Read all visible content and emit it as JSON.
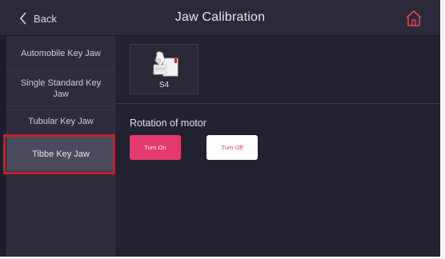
{
  "header": {
    "back_label": "Back",
    "title": "Jaw Calibration",
    "back_icon": "chevron-left-icon",
    "home_icon": "home-icon"
  },
  "sidebar": {
    "items": [
      {
        "label": "Automobile Key Jaw",
        "active": false
      },
      {
        "label": "Single Standard Key Jaw",
        "active": false
      },
      {
        "label": "Tubular Key Jaw",
        "active": false
      },
      {
        "label": "Tibbe Key Jaw",
        "active": true
      }
    ]
  },
  "main": {
    "jaw_card": {
      "label": "S4",
      "icon": "jaw-clamp-icon"
    },
    "rotation": {
      "label": "Rotation of motor",
      "turn_on_label": "Turn On",
      "turn_off_label": "Turn Off"
    }
  },
  "colors": {
    "accent": "#e53a6d",
    "highlight_border": "#c9202d",
    "background": "#1f1d2b"
  }
}
